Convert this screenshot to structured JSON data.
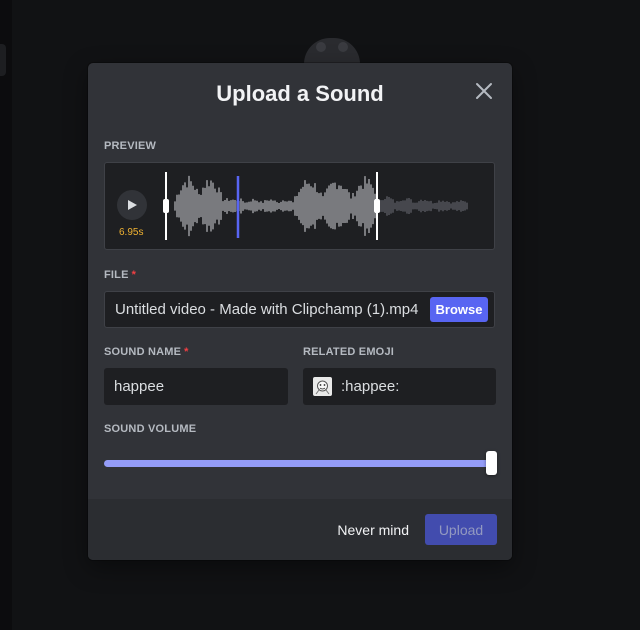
{
  "modal": {
    "title": "Upload a Sound",
    "preview": {
      "label": "PREVIEW",
      "duration": "6.95s",
      "selection_start_fraction": 0.0,
      "playhead_fraction": 0.34,
      "selection_end_fraction": 1.0
    },
    "file": {
      "label": "FILE",
      "required_mark": "*",
      "value": "Untitled video - Made with Clipchamp (1).mp4",
      "browse_label": "Browse"
    },
    "sound_name": {
      "label": "SOUND NAME",
      "required_mark": "*",
      "value": "happee"
    },
    "related_emoji": {
      "label": "RELATED EMOJI",
      "value": ":happee:"
    },
    "volume": {
      "label": "SOUND VOLUME",
      "level_percent": 100
    },
    "footer": {
      "cancel_label": "Never mind",
      "upload_label": "Upload"
    }
  },
  "colors": {
    "accent": "#5865f2",
    "slider": "#949cf7",
    "duration": "#f0b232",
    "required": "#f23f43",
    "playhead": "#5865f2"
  }
}
